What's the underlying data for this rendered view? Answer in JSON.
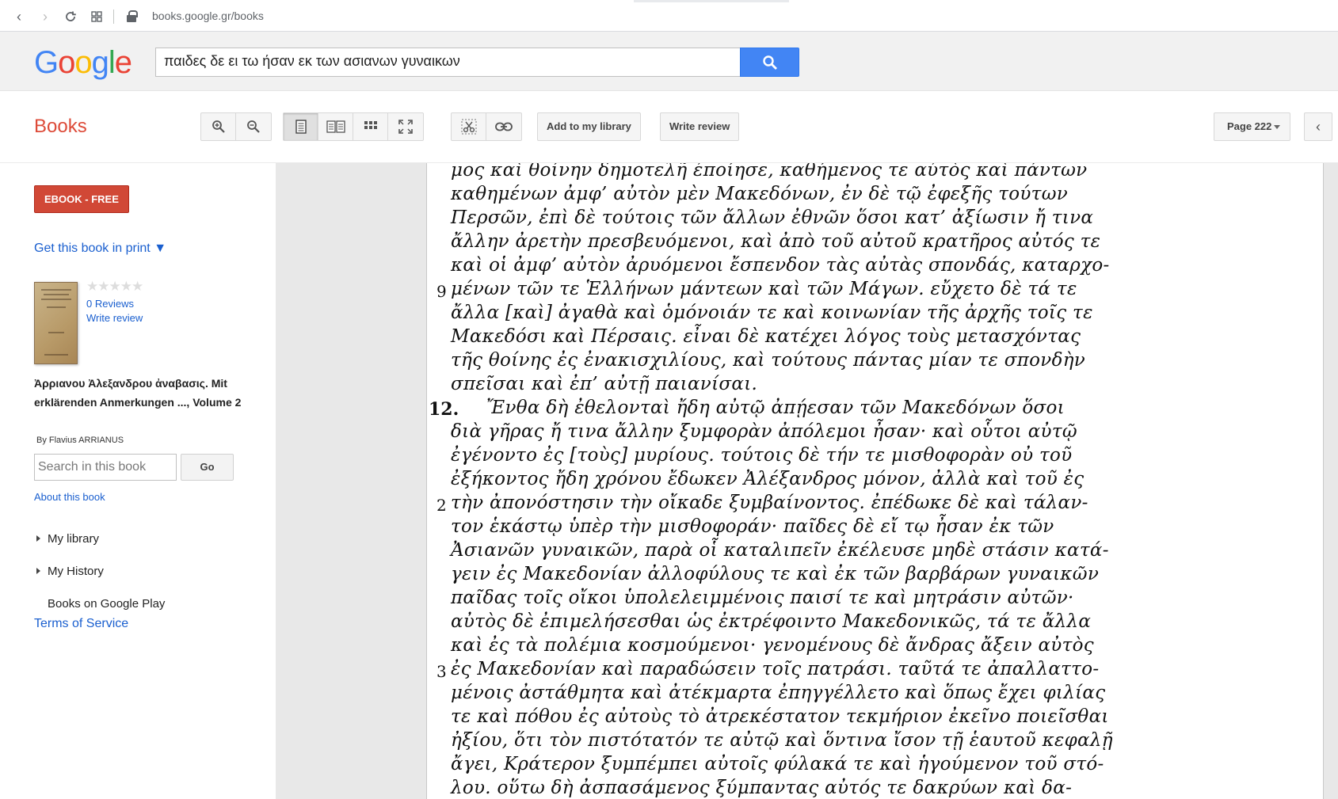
{
  "browser": {
    "url": "books.google.gr/books"
  },
  "search": {
    "logo": "Google",
    "query": "παιδες δε ει τω ήσαν εκ των ασιανων γυναικων"
  },
  "toolbar": {
    "books_label": "Books",
    "add_library": "Add to my library",
    "write_review": "Write review",
    "page_label": "Page 222"
  },
  "sidebar": {
    "ebook": "EBOOK - FREE",
    "get_print": "Get this book in print ▼",
    "stars": "★★★★★",
    "reviews": "0 Reviews",
    "write_review": "Write review",
    "title": "Ἀρριανου Ἀλεξανδρου ἀναβασις. Mit erklärenden Anmerkungen ..., Volume 2",
    "byline": "By Flavius ARRIANUS",
    "search_placeholder": "Search in this book",
    "go": "Go",
    "about": "About this book",
    "nav": [
      "My library",
      "My History",
      "Books on Google Play"
    ],
    "terms": "Terms of Service"
  },
  "page_text": {
    "lines": [
      "μος καὶ θοίνην δημοτελῆ ἐποίησε, καθήμενος τε αὐτὸς καὶ πάντων",
      "καθημένων ἀμφ’ αὐτὸν μὲν Μακεδόνων, ἐν δὲ τῷ ἐφεξῆς τούτων",
      "Περσῶν, ἐπὶ δὲ τούτοις τῶν ἄλλων ἐθνῶν ὅσοι κατ’ ἀξίωσιν ἤ τινα",
      "ἄλλην ἀρετὴν πρεσβευόμενοι, καὶ ἀπὸ τοῦ αὐτοῦ κρατῆρος αὐτός τε",
      "καὶ οἱ ἀμφ’ αὐτὸν ἀρυόμενοι ἔσπενδον τὰς αὐτὰς σπονδάς, καταρχο-",
      "μένων τῶν τε Ἑλλήνων μάντεων καὶ τῶν Μάγων. εὔχετο δὲ τά τε",
      "ἄλλα [καὶ] ἀγαθὰ καὶ ὁμόνοιάν τε καὶ κοινωνίαν τῆς ἀρχῆς τοῖς τε",
      "Μακεδόσι καὶ Πέρσαις. εἶναι δὲ κατέχει λόγος τοὺς μετασχόντας",
      "τῆς θοίνης ἐς ἐνακισχιλίους, καὶ τούτους πάντας μίαν τε σπονδὴν",
      "σπεῖσαι καὶ ἐπ’ αὐτῇ παιανίσαι.",
      "Ἔνθα δὴ ἐθελονταὶ ἤδη αὐτῷ ἀπῄεσαν τῶν Μακεδόνων ὅσοι",
      "διὰ γῆρας ἤ τινα ἄλλην ξυμφορὰν ἀπόλεμοι ἦσαν· καὶ οὗτοι αὐτῷ",
      "ἐγένοντο ἐς [τοὺς] μυρίους. τούτοις δὲ τήν τε μισθοφορὰν οὐ τοῦ",
      "ἐξήκοντος ἤδη χρόνου ἔδωκεν Ἀλέξανδρος μόνον, ἀλλὰ καὶ τοῦ ἐς",
      "τὴν ἀπονόστησιν τὴν οἴκαδε ξυμβαίνοντος. ἐπέδωκε δὲ καὶ τάλαν-",
      "τον ἑκάστῳ ὑπὲρ τὴν μισθοφοράν· παῖδες δὲ εἴ τῳ ἦσαν ἐκ τῶν",
      "Ἀσιανῶν γυναικῶν, παρὰ οἷ καταλιπεῖν ἐκέλευσε μηδὲ στάσιν κατά-",
      "γειν ἐς Μακεδονίαν ἀλλοφύλους τε καὶ ἐκ τῶν βαρβάρων γυναικῶν",
      "παῖδας τοῖς οἴκοι ὑπολελειμμένοις παισί τε καὶ μητράσιν αὐτῶν·",
      "αὐτὸς δὲ ἐπιμελήσεσθαι ὡς ἐκτρέφοιντο Μακεδονικῶς, τά τε ἄλλα",
      "καὶ ἐς τὰ πολέμια κοσμούμενοι· γενομένους δὲ ἄνδρας ἄξειν αὐτὸς",
      "ἐς Μακεδονίαν καὶ παραδώσειν τοῖς πατράσι. ταῦτά τε ἀπαλλαττο-",
      "μένοις ἀστάθμητα καὶ ἀτέκμαρτα ἐπηγγέλλετο καὶ ὅπως ἔχει φιλίας",
      "τε καὶ πόθου ἐς αὐτοὺς τὸ ἀτρεκέστατον τεκμήριον ἐκεῖνο ποιεῖσθαι",
      "ἠξίου, ὅτι τὸν πιστότατόν τε αὐτῷ καὶ ὅντινα ἴσον τῇ ἑαυτοῦ κεφαλῇ",
      "ἄγει, Κράτερον ξυμπέμπει αὐτοῖς φύλακά τε καὶ ἡγούμενον τοῦ στό-",
      "λου. οὕτω δὴ ἀσπασάμενος ξύμπαντας αὐτός τε δακρύων καὶ δα-"
    ],
    "margin_numbers": [
      "9",
      "12.",
      "2",
      "3"
    ]
  }
}
